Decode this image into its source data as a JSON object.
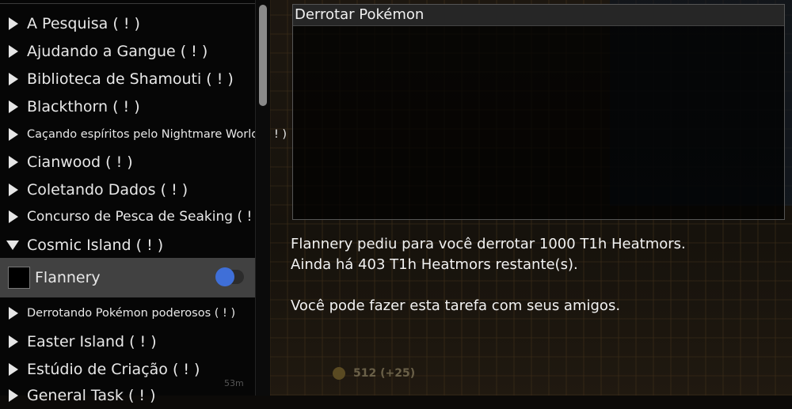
{
  "sidebar": {
    "items": [
      {
        "label": "A Pesquisa  ( ! )",
        "size": "normal",
        "expanded": false
      },
      {
        "label": "Ajudando a Gangue  ( ! )",
        "size": "normal",
        "expanded": false
      },
      {
        "label": "Biblioteca de Shamouti  ( ! )",
        "size": "normal",
        "expanded": false
      },
      {
        "label": "Blackthorn  ( ! )",
        "size": "normal",
        "expanded": false
      },
      {
        "label": "Caçando espíritos pelo Nightmare World.  ( ! )",
        "size": "small",
        "expanded": false
      },
      {
        "label": "Cianwood  ( ! )",
        "size": "normal",
        "expanded": false
      },
      {
        "label": "Coletando Dados  ( ! )",
        "size": "normal",
        "expanded": false
      },
      {
        "label": "Concurso de Pesca de Seaking  ( ! )",
        "size": "mid",
        "expanded": false
      },
      {
        "label": "Cosmic Island  ( ! )",
        "size": "normal",
        "expanded": true
      }
    ],
    "selected_task": {
      "label": "Flannery",
      "toggle_on": true
    },
    "items_after": [
      {
        "label": "Derrotando Pokémon poderosos  ( ! )",
        "size": "small"
      },
      {
        "label": "Easter Island  ( ! )",
        "size": "normal"
      },
      {
        "label": "Estúdio de Criação  ( ! )",
        "size": "normal"
      },
      {
        "label": "General Task  ( ! )",
        "size": "normal"
      }
    ]
  },
  "objective": {
    "title": "Derrotar Pokémon"
  },
  "description": {
    "line1": "Flannery pediu para você derrotar 1000 T1h Heatmors.",
    "line2": "Ainda há 403 T1h Heatmors restante(s).",
    "line3": "Você pode fazer esta tarefa com seus amigos."
  },
  "hud": {
    "coins": "512",
    "coins_extra": "(+25)",
    "timer": "53m"
  },
  "colors": {
    "selected_row": "#414141",
    "toggle_knob": "#3f6fd8",
    "sidebar_bg": "#060606"
  }
}
